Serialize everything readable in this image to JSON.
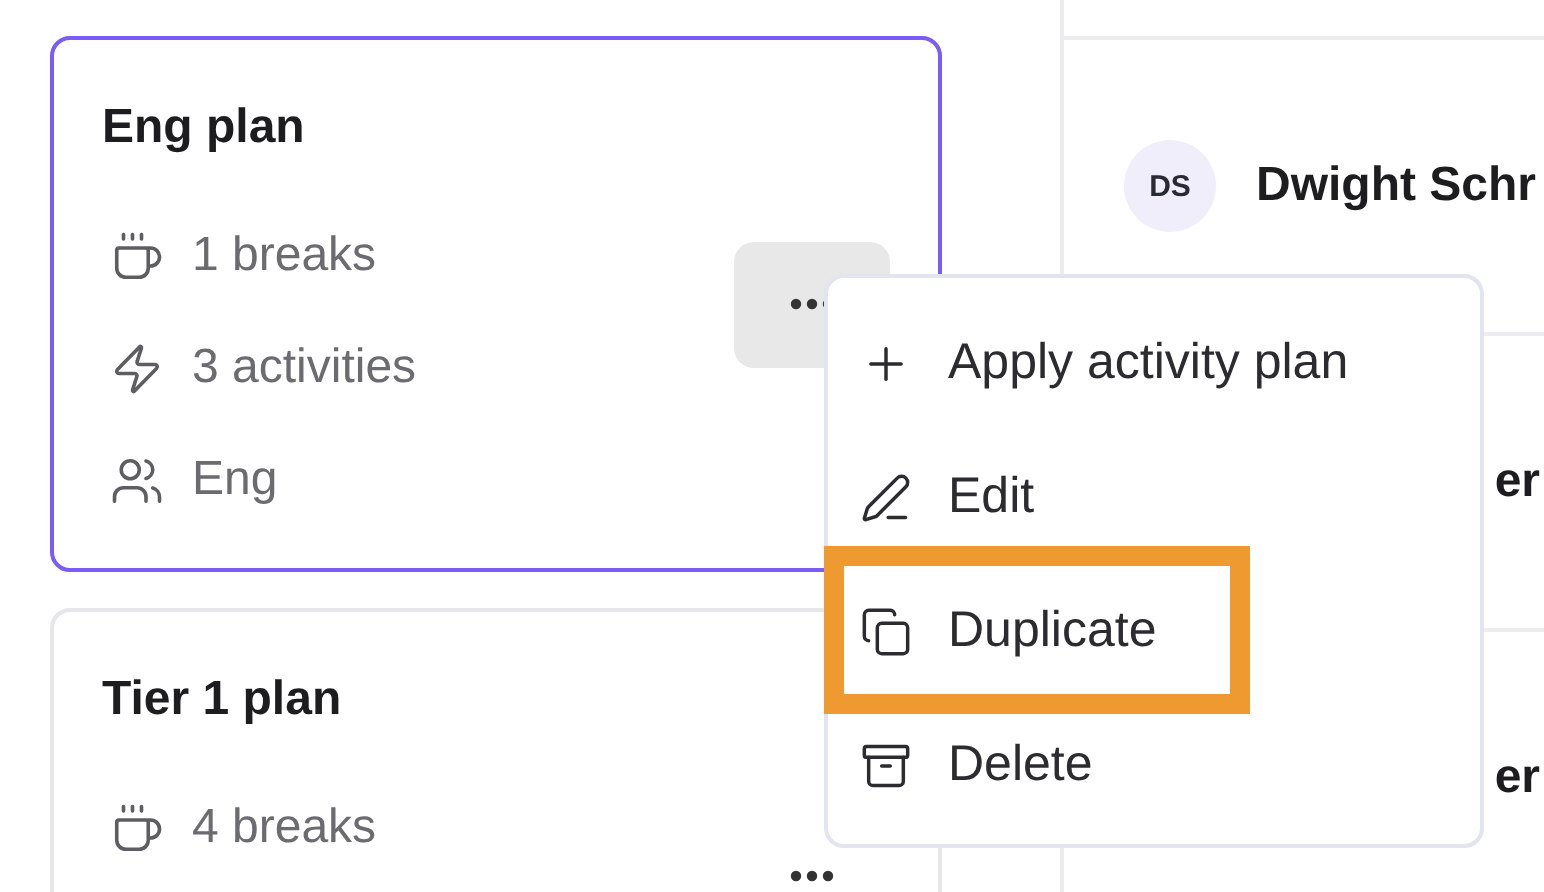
{
  "plans": [
    {
      "title": "Eng plan",
      "selected": true,
      "menu_open": true,
      "stats": [
        {
          "kind": "breaks",
          "text": "1 breaks"
        },
        {
          "kind": "activities",
          "text": "3 activities"
        },
        {
          "kind": "team",
          "text": "Eng"
        }
      ]
    },
    {
      "title": "Tier 1 plan",
      "selected": false,
      "menu_open": false,
      "stats": [
        {
          "kind": "breaks",
          "text": "4 breaks"
        }
      ]
    }
  ],
  "people": [
    {
      "avatar": "DS",
      "name": "Dwight Schr"
    },
    {
      "name": "er"
    },
    {
      "name": "er"
    }
  ],
  "menu": {
    "items": [
      {
        "kind": "apply",
        "label": "Apply activity plan",
        "highlighted": false
      },
      {
        "kind": "edit",
        "label": "Edit",
        "highlighted": false
      },
      {
        "kind": "duplicate",
        "label": "Duplicate",
        "highlighted": true
      },
      {
        "kind": "delete",
        "label": "Delete",
        "highlighted": false
      }
    ]
  }
}
